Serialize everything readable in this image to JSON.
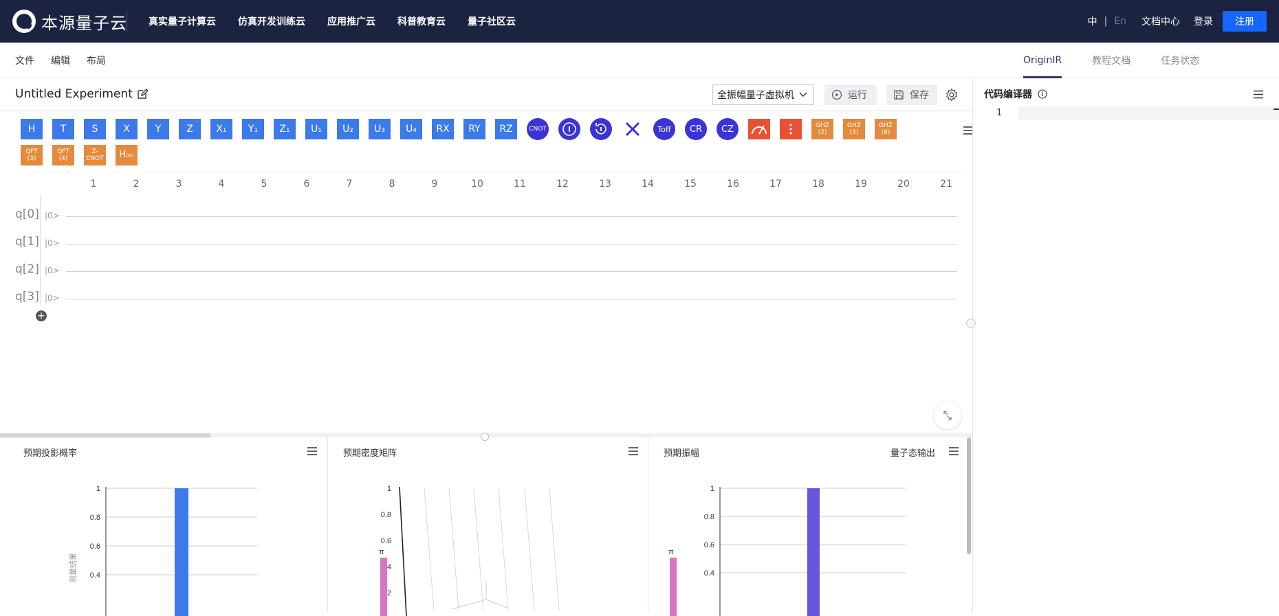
{
  "topbar": {
    "logo_text": "本源量子云",
    "nav": [
      "真实量子计算云",
      "仿真开发训练云",
      "应用推广云",
      "科普教育云",
      "量子社区云"
    ],
    "lang_zh": "中",
    "lang_sep": "|",
    "lang_en": "En",
    "doc_center": "文档中心",
    "login": "登录",
    "register": "注册"
  },
  "menubar": {
    "file": "文件",
    "edit": "编辑",
    "layout": "布局",
    "right_tabs": [
      "OriginIR",
      "教程文档",
      "任务状态"
    ]
  },
  "experiment": {
    "title": "Untitled Experiment",
    "backend": "全振幅量子虚拟机",
    "run": "运行",
    "save": "保存"
  },
  "gates": {
    "row1": [
      "H",
      "T",
      "S",
      "X",
      "Y",
      "Z",
      "X₁",
      "Y₁",
      "Z₁",
      "U₁",
      "U₂",
      "U₃",
      "U₄",
      "RX",
      "RY",
      "RZ"
    ],
    "cnot": "CNOT",
    "toff": "Toff",
    "cr": "CR",
    "cz": "CZ",
    "ghz2": "GHZ\n(2)",
    "ghz3": "GHZ\n(3)",
    "ghz6": "GHZ\n(6)",
    "qft3": "QFT\n(3)",
    "qft4": "QFT\n(4)",
    "zcnot": "Z-\nCNOT",
    "h_multi": "H₍₆₎"
  },
  "columns": [
    "1",
    "2",
    "3",
    "4",
    "5",
    "6",
    "7",
    "8",
    "9",
    "10",
    "11",
    "12",
    "13",
    "14",
    "15",
    "16",
    "17",
    "18",
    "19",
    "20",
    "21"
  ],
  "qubits": [
    {
      "label": "q[0]",
      "ket": "|0>"
    },
    {
      "label": "q[1]",
      "ket": "|0>"
    },
    {
      "label": "q[2]",
      "ket": "|0>"
    },
    {
      "label": "q[3]",
      "ket": "|0>"
    }
  ],
  "add_qubit": "+",
  "panels": {
    "prob": {
      "title": "预期投影概率",
      "ylabel": "测量结果"
    },
    "density": {
      "title": "预期密度矩阵",
      "pi_label": "π"
    },
    "amp": {
      "title": "预期振幅",
      "extra": "量子态输出",
      "pi_label": "π"
    }
  },
  "chart_data": [
    {
      "type": "bar",
      "title": "预期投影概率",
      "ylabel": "测量结果",
      "yticks": [
        "1",
        "0.8",
        "0.6",
        "0.4"
      ],
      "ylim": [
        0,
        1
      ],
      "values": [
        1
      ],
      "color": "#3b7ae8"
    },
    {
      "type": "bar",
      "title": "预期密度矩阵",
      "yticks": [
        "1",
        "0.8",
        "0.6",
        "0.4",
        "0.2"
      ],
      "ylim": [
        0,
        1
      ]
    },
    {
      "type": "bar",
      "title": "预期振幅",
      "yticks": [
        "1",
        "0.8",
        "0.6",
        "0.4"
      ],
      "ylim": [
        0,
        1
      ],
      "values": [
        1
      ],
      "color": "#6655dd"
    }
  ],
  "editor": {
    "title": "代码编译器",
    "line_number": "1"
  },
  "colors": {
    "topbar": "#1b2340",
    "gate_blue": "#3b7ae8",
    "gate_orange": "#e48a3c",
    "gate_round": "#3a34d6",
    "register": "#1666ff"
  }
}
